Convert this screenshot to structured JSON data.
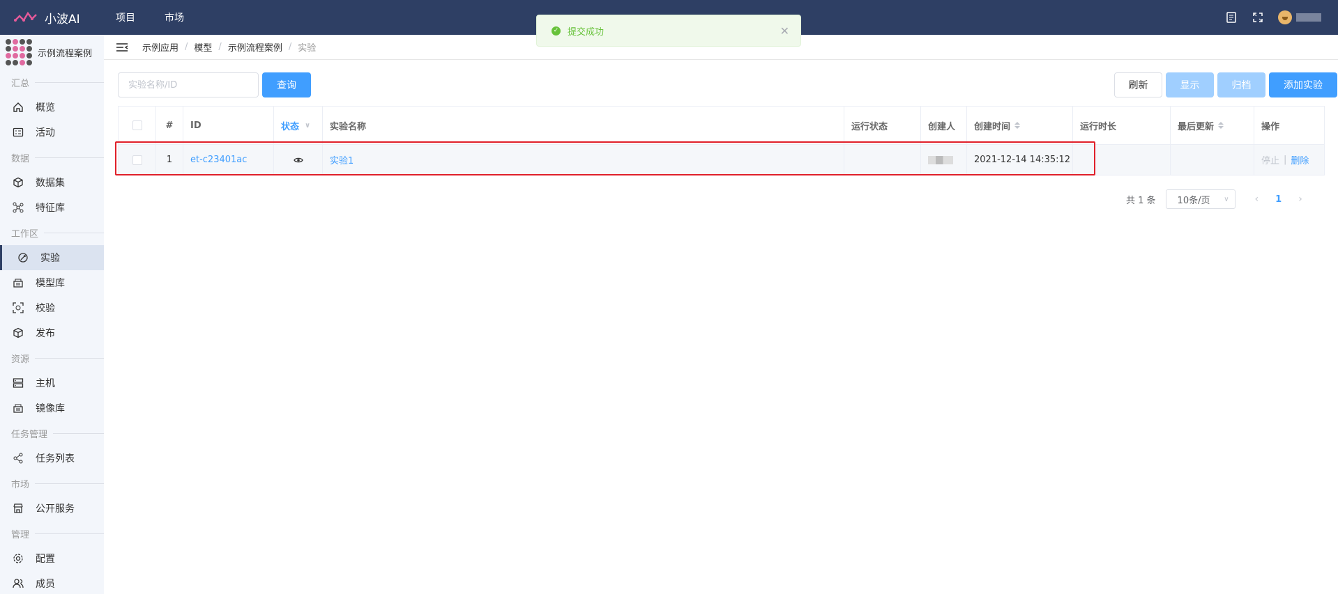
{
  "header": {
    "brand": "小波AI",
    "nav": [
      "项目",
      "市场"
    ]
  },
  "toast": {
    "message": "提交成功",
    "icon": "check-circle-icon",
    "color": "#67c23a"
  },
  "sidebar": {
    "project_name": "示例流程案例",
    "sections": [
      {
        "title": "汇总",
        "items": [
          {
            "label": "概览",
            "icon": "home-icon"
          },
          {
            "label": "活动",
            "icon": "activity-icon"
          }
        ]
      },
      {
        "title": "数据",
        "items": [
          {
            "label": "数据集",
            "icon": "cube-icon"
          },
          {
            "label": "特征库",
            "icon": "graph-nodes-icon"
          }
        ]
      },
      {
        "title": "工作区",
        "items": [
          {
            "label": "实验",
            "icon": "experiment-icon",
            "active": true
          },
          {
            "label": "模型库",
            "icon": "model-icon"
          },
          {
            "label": "校验",
            "icon": "scan-icon"
          },
          {
            "label": "发布",
            "icon": "package-icon"
          }
        ]
      },
      {
        "title": "资源",
        "items": [
          {
            "label": "主机",
            "icon": "server-icon"
          },
          {
            "label": "镜像库",
            "icon": "image-repo-icon"
          }
        ]
      },
      {
        "title": "任务管理",
        "items": [
          {
            "label": "任务列表",
            "icon": "share-nodes-icon"
          }
        ]
      },
      {
        "title": "市场",
        "items": [
          {
            "label": "公开服务",
            "icon": "store-icon"
          }
        ]
      },
      {
        "title": "管理",
        "items": [
          {
            "label": "配置",
            "icon": "gear-icon"
          },
          {
            "label": "成员",
            "icon": "users-icon"
          }
        ]
      }
    ]
  },
  "breadcrumb": [
    "示例应用",
    "模型",
    "示例流程案例",
    "实验"
  ],
  "toolbar": {
    "search_placeholder": "实验名称/ID",
    "query_label": "查询",
    "refresh_label": "刷新",
    "show_label": "显示",
    "archive_label": "归档",
    "add_label": "添加实验"
  },
  "table": {
    "headers": {
      "num": "#",
      "id": "ID",
      "status": "状态",
      "name": "实验名称",
      "run_status": "运行状态",
      "creator": "创建人",
      "created": "创建时间",
      "duration": "运行时长",
      "updated": "最后更新",
      "ops": "操作"
    },
    "rows": [
      {
        "num": "1",
        "id": "et-c23401ac",
        "status_icon": "eye-icon",
        "name": "实验1",
        "run_status": "",
        "created": "2021-12-14 14:35:12",
        "duration": "",
        "updated": "",
        "op_stop": "停止",
        "op_delete": "删除"
      }
    ]
  },
  "pagination": {
    "total": "共 1 条",
    "page_size": "10条/页",
    "current": "1"
  },
  "colors": {
    "topbar": "#2e3f64",
    "primary": "#409eff",
    "highlight": "#e0202a"
  }
}
